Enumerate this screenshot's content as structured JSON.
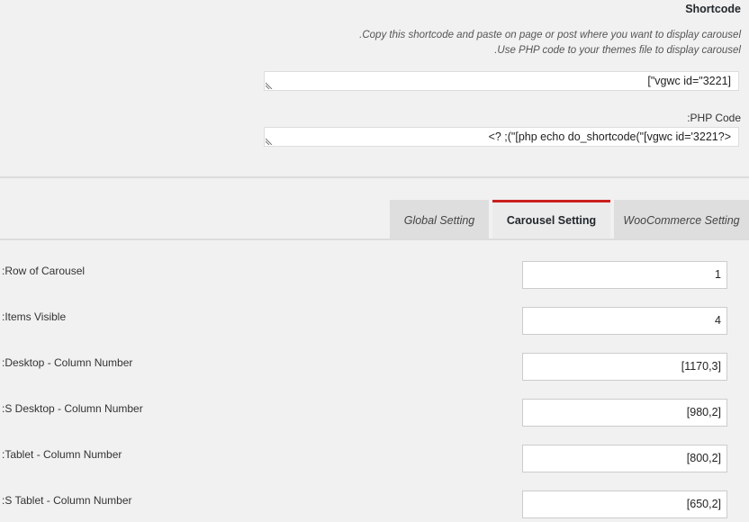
{
  "shortcode": {
    "title": "Shortcode",
    "description_line1": ".Copy this shortcode and paste on page or post where you want to display carousel",
    "description_line2": ".Use PHP code to your themes file to display carousel",
    "shortcode_value": "[\"vgwc id=\"3221]",
    "php_label": ":PHP Code",
    "php_value": "<? ;(\"[php echo do_shortcode(\"[vgwc id='3221?>"
  },
  "tabs": [
    {
      "label": "Global Setting",
      "active": false
    },
    {
      "label": "Carousel Setting",
      "active": true
    },
    {
      "label": "WooCommerce Setting",
      "active": false
    }
  ],
  "colors": {
    "active_tab_accent": "#cc1f1f",
    "page_background": "#f1f1f1",
    "tab_background": "#dedede"
  },
  "carousel_fields": [
    {
      "label": ":Row of Carousel",
      "value": "1"
    },
    {
      "label": ":Items Visible",
      "value": "4"
    },
    {
      "label": ":Desktop - Column Number",
      "value": "[1170,3]"
    },
    {
      "label": ":S Desktop - Column Number",
      "value": "[980,2]"
    },
    {
      "label": ":Tablet - Column Number",
      "value": "[800,2]"
    },
    {
      "label": ":S Tablet - Column Number",
      "value": "[650,2]"
    }
  ]
}
